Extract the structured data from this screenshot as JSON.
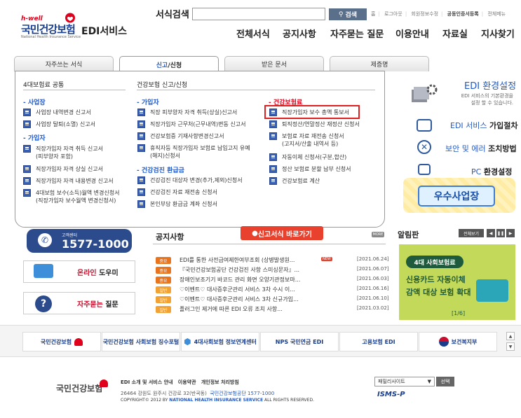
{
  "header": {
    "brand_small": "h-well",
    "brand_main": "국민건강보험",
    "brand_sub": "National Health Insurance Service",
    "service_name": "EDI서비스",
    "search_label": "서식검색",
    "search_value": "",
    "search_button": "검색",
    "util_links": [
      "홈",
      "로그아웃",
      "회원정보수정",
      "공동인증서등록",
      "전체메뉴"
    ],
    "gnb": [
      "전체서식",
      "공지사항",
      "자주묻는 질문",
      "이용안내",
      "자료실",
      "지사찾기"
    ]
  },
  "tabs": [
    {
      "label": "자주쓰는 서식"
    },
    {
      "label_a": "신고",
      "label_b": "/신청"
    },
    {
      "label": "받은 문서"
    },
    {
      "label": "제증명"
    }
  ],
  "panel": {
    "col1_title": "4대보험료 공통",
    "col2_title": "건강보험 신고/신청",
    "sections": {
      "workplace": "- 사업장",
      "subscriber": "- 가입자",
      "subscriber2": "- 가입자",
      "checkup": "- 건강검진 환급금",
      "health_ins": "- 건강보험료"
    },
    "col1_workplace": [
      "사업장 내역변경 신고서",
      "사업장 탈퇴(소멸) 신고서"
    ],
    "col1_subscriber": [
      "직장가입자 자격 취득 신고서",
      "(피부양자 포함)",
      "직장가입자 자격 상실 신고서",
      "직장가입자 자격 내용변경 신고서",
      "4대보험 보수(소득)월액 변경신청서",
      "(직장가입자 보수월액 변경신청서)"
    ],
    "col2_subscriber": [
      "직장 피부양자 자격 취득(상실)신고서",
      "직장가입자 근무처(근무내역)변동 신고서",
      "건강보험증 기재사항변경신고서",
      "휴직자등 직장가입자 보험료 납입고지 유예",
      "(해지)신청서"
    ],
    "col2_checkup": [
      "건강검진 대상자 변경(추가,제외)신청서",
      "건강검진 자료 재전송 신청서",
      "본인부담 환급금 계좌 신청서"
    ],
    "col3": [
      "직장가입자 보수 총액 통보서",
      "퇴직정산/연말정산 재정산 신청서",
      "보험료 자료 재전송 신청서",
      "(고지서/산출 내역서 등)",
      "자동이체 신청서(구분,합산)",
      "정산 보험료 분할 납부 신청서",
      "건강보험료 계산"
    ]
  },
  "right_side": {
    "edi_env_title": "EDI 환경설정",
    "edi_env_desc1": "EDI 서비스의 기본환경을",
    "edi_env_desc2": "설정 할 수 있습니다.",
    "links": [
      {
        "a": "EDI 서비스",
        "b": "가입절차"
      },
      {
        "a": "보안 및 에러",
        "b": "조치방법"
      },
      {
        "a": "PC",
        "b": "환경설정"
      }
    ],
    "good_biz": "우수사업장"
  },
  "callcenter": {
    "label": "고객센터",
    "number": "1577-1000"
  },
  "quick": [
    {
      "a": "온라인",
      "b": "도우미"
    },
    {
      "a": "자주묻는",
      "b": "질문"
    }
  ],
  "notice": {
    "title": "공지사항",
    "cta": "신고서식 바로가기",
    "more": "MORE",
    "new_label": "NEW",
    "rows": [
      {
        "badge": "중요",
        "type": "imp",
        "text": "EDI를 통한 사전급여제한여부조회 (상병발생원...",
        "is_new": true,
        "date": "[2021.06.24]"
      },
      {
        "badge": "중요",
        "type": "imp",
        "text": "『국민건강보험공단 건강검진 사항 스미싱문자』...",
        "is_new": false,
        "date": "[2021.06.07]"
      },
      {
        "badge": "중요",
        "type": "imp",
        "text": "장애인보조기기 바코드 관리 화면 오양기관정보마...",
        "is_new": false,
        "date": "[2021.06.03]"
      },
      {
        "badge": "일반",
        "type": "gen",
        "text": "♡이벤트♡ 대사증후군관리 서비스 3차 수시 이...",
        "is_new": false,
        "date": "[2021.06.16]"
      },
      {
        "badge": "일반",
        "type": "gen",
        "text": "♡이벤트♡ 대사증후군관리 서비스 3차 신규가입...",
        "is_new": false,
        "date": "[2021.06.10]"
      },
      {
        "badge": "일반",
        "type": "gen",
        "text": "플러그인 제거에 따른 EDI 오류 조치 사항...",
        "is_new": false,
        "date": "[2021.03.02]"
      }
    ]
  },
  "alarm": {
    "title": "알림판",
    "view_all": "전체보기",
    "banner_pill": "4대 사회보험료",
    "banner_l1": "신용카드 자동이체",
    "banner_l2": "감액 대상 보험 확대",
    "page": "[1/6]"
  },
  "partners": [
    {
      "label": "국민건강보험"
    },
    {
      "label": "국민건강보험 사회보험 징수포털"
    },
    {
      "label": "4대사회보험 정보연계센터"
    },
    {
      "label": "NPS 국민연금 EDI"
    },
    {
      "label": "고용보험 EDI"
    },
    {
      "label": "보건복지부"
    }
  ],
  "footer": {
    "logo": "국민건강보험",
    "links": [
      "EDI 소개 및 서비스 안내",
      "이용약관",
      "개인정보 처리방침"
    ],
    "address": "26464 강원도 원주시 건강로 32(반곡동)",
    "org": "국민건강보험공단 1577-1000",
    "copy_pre": "COPYRIGHT© 2012 BY",
    "copy_org": "NATIONAL HEALTH INSURANCE SERVICE",
    "copy_post": "ALL RIGHTS RESERVED.",
    "family_site": "패밀리사이트",
    "family_go": "선택",
    "isms": "ISMS-P"
  },
  "colors": {
    "primary": "#2159c5",
    "navy": "#2c4b8c",
    "red": "#e02020",
    "banner": "#c2d95a"
  }
}
